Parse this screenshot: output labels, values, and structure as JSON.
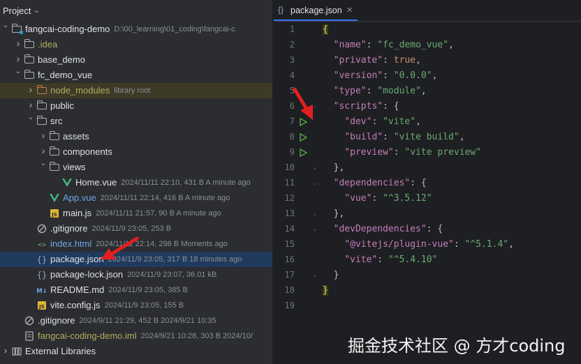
{
  "project_panel": {
    "title": "Project",
    "tree": [
      {
        "indent": 0,
        "arrow": "expanded",
        "icon": "module-folder",
        "name": "fangcai-coding-demo",
        "meta": "D:\\00_learning\\01_coding\\fangcai-c",
        "color": "#dfe1e5"
      },
      {
        "indent": 1,
        "arrow": "collapsed",
        "icon": "folder",
        "name": ".idea",
        "meta": "",
        "color": "#b3ae60"
      },
      {
        "indent": 1,
        "arrow": "collapsed",
        "icon": "folder",
        "name": "base_demo",
        "meta": "",
        "color": "#dfe1e5"
      },
      {
        "indent": 1,
        "arrow": "expanded",
        "icon": "folder",
        "name": "fc_demo_vue",
        "meta": "",
        "color": "#dfe1e5"
      },
      {
        "indent": 2,
        "arrow": "collapsed",
        "icon": "folder-orange",
        "name": "node_modules",
        "meta": "library root",
        "color": "#b3ae60",
        "highlight": true
      },
      {
        "indent": 2,
        "arrow": "collapsed",
        "icon": "folder",
        "name": "public",
        "meta": "",
        "color": "#dfe1e5"
      },
      {
        "indent": 2,
        "arrow": "expanded",
        "icon": "folder",
        "name": "src",
        "meta": "",
        "color": "#dfe1e5"
      },
      {
        "indent": 3,
        "arrow": "collapsed",
        "icon": "folder",
        "name": "assets",
        "meta": "",
        "color": "#dfe1e5"
      },
      {
        "indent": 3,
        "arrow": "collapsed",
        "icon": "folder",
        "name": "components",
        "meta": "",
        "color": "#dfe1e5"
      },
      {
        "indent": 3,
        "arrow": "expanded",
        "icon": "folder",
        "name": "views",
        "meta": "",
        "color": "#dfe1e5"
      },
      {
        "indent": 4,
        "arrow": "none",
        "icon": "vue",
        "name": "Home.vue",
        "meta": "2024/11/11 22:10, 431 B A minute ago",
        "color": "#dfe1e5"
      },
      {
        "indent": 3,
        "arrow": "none",
        "icon": "vue",
        "name": "App.vue",
        "meta": "2024/11/11 22:14, 416 B A minute ago",
        "color": "#6ea6e8"
      },
      {
        "indent": 3,
        "arrow": "none",
        "icon": "js",
        "name": "main.js",
        "meta": "2024/11/11 21:57, 90 B A minute ago",
        "color": "#dfe1e5"
      },
      {
        "indent": 2,
        "arrow": "none",
        "icon": "ignore",
        "name": ".gitignore",
        "meta": "2024/11/9 23:05, 253 B",
        "color": "#dfe1e5"
      },
      {
        "indent": 2,
        "arrow": "none",
        "icon": "html",
        "name": "index.html",
        "meta": "2024/11/11 22:14, 298 B Moments ago",
        "color": "#6ea6e8"
      },
      {
        "indent": 2,
        "arrow": "none",
        "icon": "json",
        "name": "package.json",
        "meta": "2024/11/9 23:05, 317 B 18 minutes ago",
        "color": "#dfe1e5",
        "selected": true
      },
      {
        "indent": 2,
        "arrow": "none",
        "icon": "json",
        "name": "package-lock.json",
        "meta": "2024/11/9 23:07, 36.01 kB",
        "color": "#dfe1e5"
      },
      {
        "indent": 2,
        "arrow": "none",
        "icon": "md",
        "name": "README.md",
        "meta": "2024/11/9 23:05, 385 B",
        "color": "#dfe1e5"
      },
      {
        "indent": 2,
        "arrow": "none",
        "icon": "js",
        "name": "vite.config.js",
        "meta": "2024/11/9 23:05, 155 B",
        "color": "#dfe1e5"
      },
      {
        "indent": 1,
        "arrow": "none",
        "icon": "ignore",
        "name": ".gitignore",
        "meta": "2024/9/11 21:29, 452 B 2024/9/21 10:35",
        "color": "#dfe1e5"
      },
      {
        "indent": 1,
        "arrow": "none",
        "icon": "iml",
        "name": "fangcai-coding-demo.iml",
        "meta": "2024/9/21 10:28, 303 B 2024/10/",
        "color": "#b3ae60"
      },
      {
        "indent": 0,
        "arrow": "collapsed",
        "icon": "libraries",
        "name": "External Libraries",
        "meta": "",
        "color": "#dfe1e5"
      }
    ]
  },
  "editor": {
    "tab_label": "package.json",
    "lines": [
      [
        {
          "t": "{",
          "c": "brace-hl"
        }
      ],
      [
        {
          "t": "  "
        },
        {
          "t": "\"name\"",
          "c": "key"
        },
        {
          "t": ": "
        },
        {
          "t": "\"fc_demo_vue\"",
          "c": "str"
        },
        {
          "t": ","
        }
      ],
      [
        {
          "t": "  "
        },
        {
          "t": "\"private\"",
          "c": "key"
        },
        {
          "t": ": "
        },
        {
          "t": "true",
          "c": "kw"
        },
        {
          "t": ","
        }
      ],
      [
        {
          "t": "  "
        },
        {
          "t": "\"version\"",
          "c": "key"
        },
        {
          "t": ": "
        },
        {
          "t": "\"0.0.0\"",
          "c": "str"
        },
        {
          "t": ","
        }
      ],
      [
        {
          "t": "  "
        },
        {
          "t": "\"type\"",
          "c": "key"
        },
        {
          "t": ": "
        },
        {
          "t": "\"module\"",
          "c": "str"
        },
        {
          "t": ","
        }
      ],
      [
        {
          "t": "  "
        },
        {
          "t": "\"scripts\"",
          "c": "key"
        },
        {
          "t": ": {"
        }
      ],
      [
        {
          "t": "    "
        },
        {
          "t": "\"dev\"",
          "c": "key"
        },
        {
          "t": ": "
        },
        {
          "t": "\"vite\"",
          "c": "str"
        },
        {
          "t": ","
        }
      ],
      [
        {
          "t": "    "
        },
        {
          "t": "\"build\"",
          "c": "key"
        },
        {
          "t": ": "
        },
        {
          "t": "\"vite build\"",
          "c": "str"
        },
        {
          "t": ","
        }
      ],
      [
        {
          "t": "    "
        },
        {
          "t": "\"preview\"",
          "c": "key"
        },
        {
          "t": ": "
        },
        {
          "t": "\"vite preview\"",
          "c": "str"
        }
      ],
      [
        {
          "t": "  },"
        }
      ],
      [
        {
          "t": "  "
        },
        {
          "t": "\"dependencies\"",
          "c": "key"
        },
        {
          "t": ": {"
        }
      ],
      [
        {
          "t": "    "
        },
        {
          "t": "\"vue\"",
          "c": "key"
        },
        {
          "t": ": "
        },
        {
          "t": "\"^3.5.12\"",
          "c": "str"
        }
      ],
      [
        {
          "t": "  },"
        }
      ],
      [
        {
          "t": "  "
        },
        {
          "t": "\"devDependencies\"",
          "c": "key"
        },
        {
          "t": ": {"
        }
      ],
      [
        {
          "t": "    "
        },
        {
          "t": "\"@vitejs/plugin-vue\"",
          "c": "key"
        },
        {
          "t": ": "
        },
        {
          "t": "\"^5.1.4\"",
          "c": "str"
        },
        {
          "t": ","
        }
      ],
      [
        {
          "t": "    "
        },
        {
          "t": "\"vite\"",
          "c": "key"
        },
        {
          "t": ": "
        },
        {
          "t": "\"^5.4.10\"",
          "c": "str"
        }
      ],
      [
        {
          "t": "  }"
        }
      ],
      [
        {
          "t": "}",
          "c": "brace-hl"
        }
      ],
      []
    ],
    "run_gutter_lines": [
      7,
      8,
      9
    ],
    "fold_lines": [
      6,
      10,
      11,
      13,
      14,
      17
    ]
  },
  "watermark": "掘金技术社区 @ 方才coding",
  "colors": {
    "annotation_arrow": "#e02020",
    "accent": "#3574f0"
  }
}
